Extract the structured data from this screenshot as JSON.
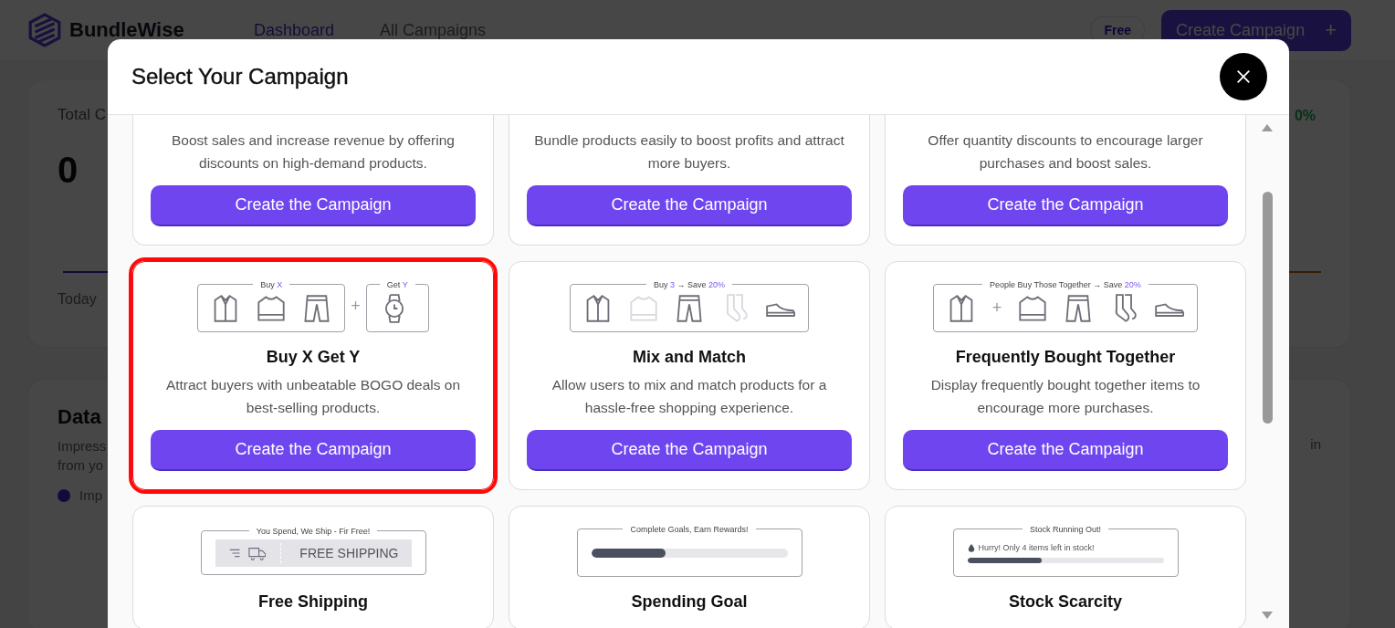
{
  "app": {
    "logo": "BundleWise",
    "nav": [
      {
        "label": "Dashboard",
        "selected": true
      },
      {
        "label": "All Campaigns",
        "selected": false
      }
    ],
    "plan_badge": "Free",
    "create_button": {
      "label": "Create Campaign",
      "icon": "+"
    }
  },
  "dashboard": {
    "stat_card": {
      "title": "Total C",
      "value": "0",
      "period": "Today",
      "change": "0%"
    },
    "data_card": {
      "title": "Data",
      "description_lines": [
        "Impress",
        "from yo"
      ],
      "legend": "Imp",
      "side_text": "in"
    }
  },
  "modal": {
    "title": "Select Your Campaign",
    "campaigns": [
      {
        "description": "Boost sales and increase revenue by offering discounts on high-demand products.",
        "button": "Create the Campaign",
        "highlighted": false
      },
      {
        "description": "Bundle products easily to boost profits and attract more buyers.",
        "button": "Create the Campaign",
        "highlighted": false
      },
      {
        "description": "Offer quantity discounts to encourage larger purchases and boost sales.",
        "button": "Create the Campaign",
        "highlighted": false
      },
      {
        "illustration": {
          "kind": "product_groups",
          "joiner": "+",
          "groups": [
            {
              "legend": [
                {
                  "text": "Buy ",
                  "accent": false
                },
                {
                  "text": "X",
                  "accent": true
                }
              ],
              "icons": [
                {
                  "kind": "shirt",
                  "faded": false
                },
                {
                  "kind": "tshirt",
                  "faded": false
                },
                {
                  "kind": "pants",
                  "faded": false
                }
              ]
            },
            {
              "legend": [
                {
                  "text": "Get ",
                  "accent": false
                },
                {
                  "text": "Y",
                  "accent": true
                }
              ],
              "icons": [
                {
                  "kind": "watch",
                  "faded": false
                }
              ]
            }
          ]
        },
        "title": "Buy X Get Y",
        "description": "Attract buyers with unbeatable BOGO deals on best-selling products.",
        "button": "Create the Campaign",
        "highlighted": true
      },
      {
        "illustration": {
          "kind": "product_groups",
          "groups": [
            {
              "legend": [
                {
                  "text": "Buy ",
                  "accent": false
                },
                {
                  "text": "3",
                  "accent": true
                },
                {
                  "text": " → Save ",
                  "accent": false
                },
                {
                  "text": "20%",
                  "accent": true
                }
              ],
              "icons": [
                {
                  "kind": "shirt",
                  "faded": false
                },
                {
                  "kind": "tshirt",
                  "faded": true
                },
                {
                  "kind": "pants",
                  "faded": false
                },
                {
                  "kind": "socks",
                  "faded": true
                },
                {
                  "kind": "shoe",
                  "faded": false
                }
              ]
            }
          ]
        },
        "title": "Mix and Match",
        "description": "Allow users to mix and match products for a hassle-free shopping experience.",
        "button": "Create the Campaign",
        "highlighted": false
      },
      {
        "illustration": {
          "kind": "product_groups",
          "groups": [
            {
              "legend": [
                {
                  "text": "People Buy Those Together → Save ",
                  "accent": false
                },
                {
                  "text": "20%",
                  "accent": true
                }
              ],
              "icons": [
                {
                  "kind": "shirt",
                  "faded": false
                },
                {
                  "kind": "plus",
                  "text": "+"
                },
                {
                  "kind": "tshirt",
                  "faded": false
                },
                {
                  "kind": "pants",
                  "faded": false
                },
                {
                  "kind": "socks",
                  "faded": false
                },
                {
                  "kind": "shoe",
                  "faded": false
                }
              ]
            }
          ]
        },
        "title": "Frequently Bought Together",
        "description": "Display frequently bought together items to encourage more purchases.",
        "button": "Create the Campaign",
        "highlighted": false
      },
      {
        "illustration": {
          "kind": "shipping_banner",
          "legend": [
            {
              "text": "You Spend, We Ship - Fir Free!",
              "accent": false
            }
          ],
          "text": "FREE SHIPPING"
        },
        "title": "Free Shipping",
        "highlighted": false
      },
      {
        "illustration": {
          "kind": "progress",
          "legend": [
            {
              "text": "Complete Goals, Earn Rewards!",
              "accent": false
            }
          ],
          "level": 0.38
        },
        "title": "Spending Goal",
        "highlighted": false
      },
      {
        "illustration": {
          "kind": "progress",
          "legend": [
            {
              "text": "Stock Running Out!",
              "accent": false
            }
          ],
          "message": "Hurry! Only 4 items left in stock!",
          "level": 0.38
        },
        "title": "Stock Scarcity",
        "highlighted": false
      }
    ]
  }
}
